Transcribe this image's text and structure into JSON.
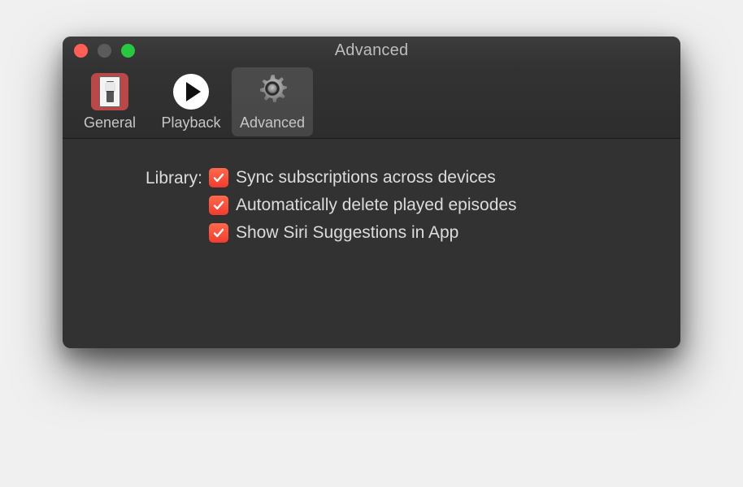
{
  "window": {
    "title": "Advanced"
  },
  "tabs": {
    "general": "General",
    "playback": "Playback",
    "advanced": "Advanced"
  },
  "section_label": "Library:",
  "options": {
    "sync": "Sync subscriptions across devices",
    "autodelete": "Automatically delete played episodes",
    "siri": "Show Siri Suggestions in App"
  }
}
